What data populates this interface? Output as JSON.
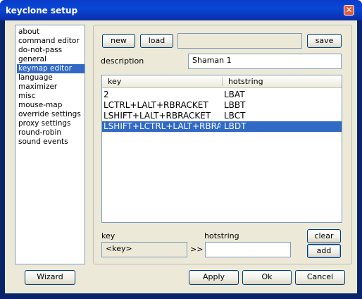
{
  "window": {
    "title": "keyclone setup"
  },
  "sidebar": {
    "items": [
      {
        "label": "about"
      },
      {
        "label": "command editor"
      },
      {
        "label": "do-not-pass"
      },
      {
        "label": "general"
      },
      {
        "label": "keymap editor",
        "selected": true
      },
      {
        "label": "language"
      },
      {
        "label": "maximizer"
      },
      {
        "label": "misc"
      },
      {
        "label": "mouse-map"
      },
      {
        "label": "override settings"
      },
      {
        "label": "proxy settings"
      },
      {
        "label": "round-robin"
      },
      {
        "label": "sound events"
      }
    ]
  },
  "toolbar": {
    "new_label": "new",
    "load_label": "load",
    "save_label": "save",
    "path_value": ""
  },
  "description": {
    "label": "description",
    "value": "Shaman 1"
  },
  "table": {
    "columns": [
      "key",
      "hotstring"
    ],
    "rows": [
      {
        "key": "2",
        "hotstring": "LBAT"
      },
      {
        "key": "LCTRL+LALT+RBRACKET",
        "hotstring": "LBBT"
      },
      {
        "key": "LSHIFT+LALT+RBRACKET",
        "hotstring": "LBCT"
      },
      {
        "key": "LSHIFT+LCTRL+LALT+RBRA",
        "hotstring": "LBDT",
        "selected": true
      }
    ]
  },
  "editor": {
    "key_label": "key",
    "hotstring_label": "hotstring",
    "key_value": "<key>",
    "arrow": ">>",
    "hotstring_value": "",
    "clear_label": "clear",
    "add_label": "add"
  },
  "footer": {
    "wizard_label": "Wizard",
    "apply_label": "Apply",
    "ok_label": "Ok",
    "cancel_label": "Cancel"
  },
  "colors": {
    "titlebar": "#0a46d2",
    "selection": "#316ac5",
    "face": "#ece9d8"
  }
}
